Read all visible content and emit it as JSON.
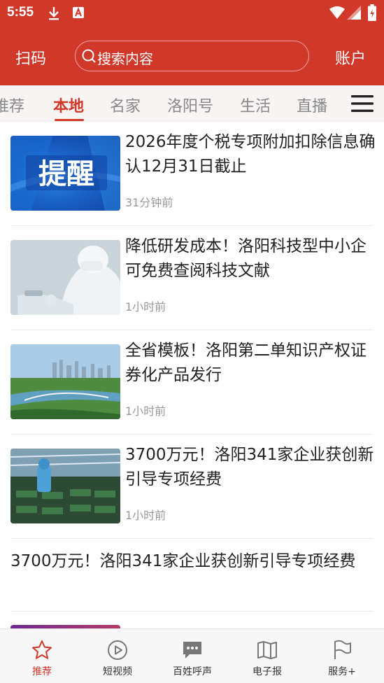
{
  "status_bar": {
    "time": "5:55"
  },
  "header": {
    "scan_label": "扫码",
    "search_placeholder": "搜索内容",
    "account_label": "账户"
  },
  "tabs": [
    {
      "label": "推荐"
    },
    {
      "label": "本地",
      "active": true
    },
    {
      "label": "名家"
    },
    {
      "label": "洛阳号"
    },
    {
      "label": "生活"
    },
    {
      "label": "直播"
    }
  ],
  "feed": [
    {
      "title": "2026年度个税专项附加扣除信息确认12月31日截止",
      "time": "31分钟前",
      "thumb_text": "提醒"
    },
    {
      "title": "降低研发成本！洛阳科技型中小企可免费查阅科技文献",
      "time": "1小时前"
    },
    {
      "title": "全省模板！洛阳第二单知识产权证券化产品发行",
      "time": "1小时前"
    },
    {
      "title": "3700万元！洛阳341家企业获创新引导专项经费",
      "time": "1小时前"
    },
    {
      "title": "3700万元！洛阳341家企业获创新引导专项经费"
    }
  ],
  "bottom_nav": [
    {
      "label": "推荐",
      "icon": "star-icon",
      "active": true
    },
    {
      "label": "短视频",
      "icon": "play-icon"
    },
    {
      "label": "百姓呼声",
      "icon": "chat-icon"
    },
    {
      "label": "电子报",
      "icon": "book-icon"
    },
    {
      "label": "服务+",
      "icon": "flag-icon"
    }
  ],
  "colors": {
    "brand": "#d0382a",
    "text": "#222222",
    "muted": "#999999"
  }
}
